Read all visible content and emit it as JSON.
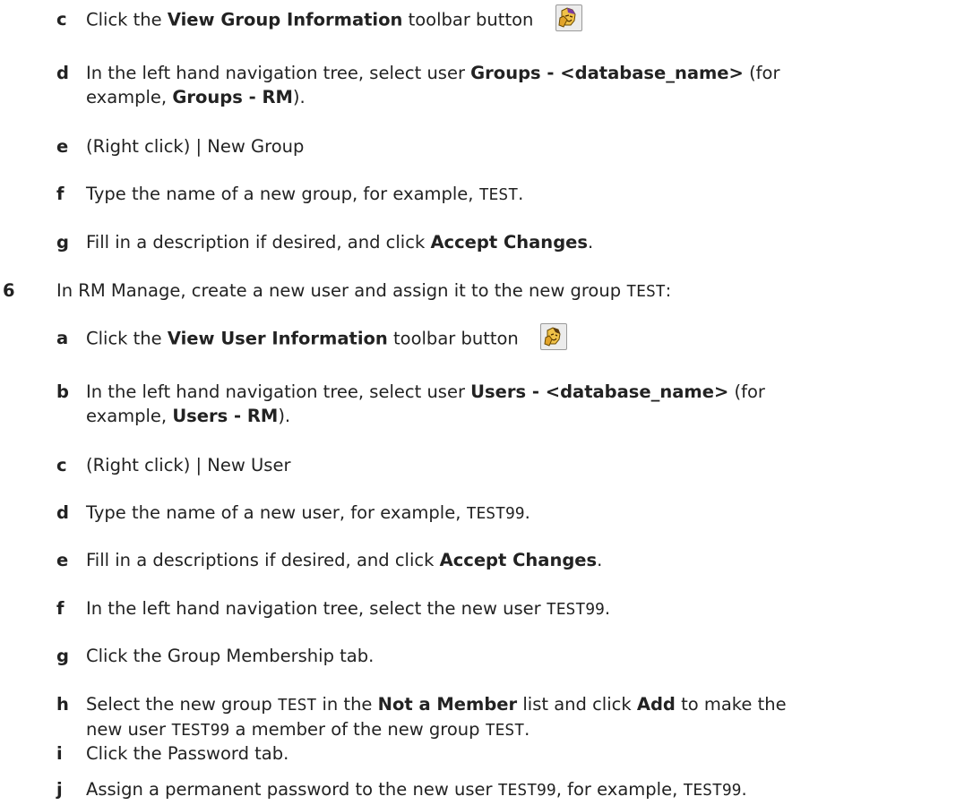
{
  "steps_5": {
    "c": {
      "letter": "c",
      "pre": "Click the ",
      "bold": "View Group Information",
      "post": " toolbar button",
      "icon": "group-information-icon"
    },
    "d": {
      "letter": "d",
      "pre": "In the left hand navigation tree, select user ",
      "bold1": "Groups - <database_name>",
      "mid": " (for",
      "line2_pre": "example, ",
      "bold2": "Groups - RM",
      "line2_post": ")."
    },
    "e": {
      "letter": "e",
      "text": "(Right click) | New Group"
    },
    "f": {
      "letter": "f",
      "pre": "Type the name of a new group, for example, ",
      "code": "TEST",
      "post": "."
    },
    "g": {
      "letter": "g",
      "pre": "Fill in a description if desired, and click ",
      "bold": "Accept Changes",
      "post": "."
    }
  },
  "step_6": {
    "number": "6",
    "pre": "In RM Manage, create a new user and assign it to the new group ",
    "code": "TEST",
    "post": ":",
    "substeps": {
      "a": {
        "letter": "a",
        "pre": "Click the ",
        "bold": "View User Information",
        "post": " toolbar button",
        "icon": "user-information-icon"
      },
      "b": {
        "letter": "b",
        "pre": "In the left hand navigation tree, select user ",
        "bold1": "Users - <database_name>",
        "mid": " (for",
        "line2_pre": "example, ",
        "bold2": "Users - RM",
        "line2_post": ")."
      },
      "c": {
        "letter": "c",
        "text": "(Right click) | New User"
      },
      "d": {
        "letter": "d",
        "pre": "Type the name of a new user, for example, ",
        "code": "TEST99",
        "post": "."
      },
      "e": {
        "letter": "e",
        "pre": "Fill in a descriptions if desired, and click ",
        "bold": "Accept Changes",
        "post": "."
      },
      "f": {
        "letter": "f",
        "pre": "In the left hand navigation tree, select the new user ",
        "code": "TEST99",
        "post": "."
      },
      "g": {
        "letter": "g",
        "text": "Click the Group Membership tab."
      },
      "h": {
        "letter": "h",
        "pre": "Select the new group ",
        "code1": "TEST",
        "mid1": " in the ",
        "bold1": "Not a Member",
        "mid2": " list and click ",
        "bold2": "Add",
        "mid3": " to make the",
        "line2_pre": "new user ",
        "code2": "TEST99",
        "line2_mid": " a member of the new group ",
        "code3": "TEST",
        "line2_post": "."
      },
      "i": {
        "letter": "i",
        "text": "Click the Password tab."
      },
      "j": {
        "letter": "j",
        "pre": "Assign a permanent password to the new user ",
        "code1": "TEST99",
        "mid": ", for example, ",
        "code2": "TEST99",
        "post": "."
      }
    }
  },
  "colors": {
    "text": "#222222",
    "background": "#ffffff"
  }
}
